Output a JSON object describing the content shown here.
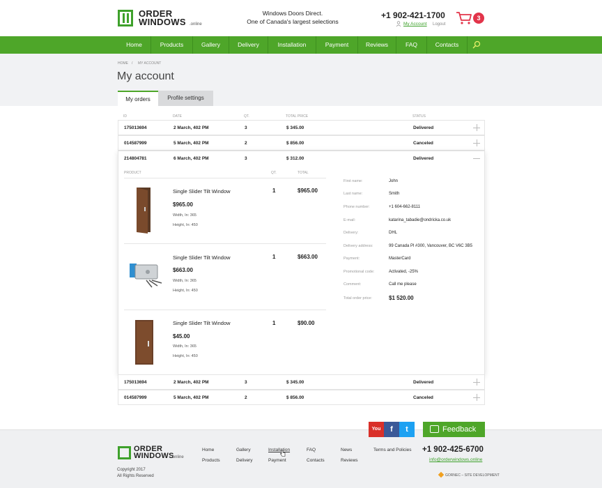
{
  "header": {
    "logo_line1": "ORDER",
    "logo_line2": "WINDOWS",
    "logo_suffix": ".online",
    "tagline1": "Windows Doors Direct.",
    "tagline2": "One of Canada's largest selections",
    "phone": "+1 902-421-1700",
    "my_account": "My Account",
    "logout": "Logout",
    "cart_count": "3"
  },
  "nav": [
    "Home",
    "Products",
    "Gallery",
    "Delivery",
    "Installation",
    "Payment",
    "Reviews",
    "FAQ",
    "Contacts"
  ],
  "breadcrumb": {
    "home": "HOME",
    "sep": "/",
    "current": "MY ACCOUNT"
  },
  "page_title": "My account",
  "tabs": {
    "orders": "My orders",
    "profile": "Profile settings"
  },
  "table_headers": {
    "id": "ID",
    "date": "DATE",
    "qty": "QT.",
    "total": "TOTAL PRICE",
    "status": "STATUS"
  },
  "orders_top": [
    {
      "id": "175013694",
      "date": "2 March, 402 PM",
      "qty": "3",
      "total": "$ 345.00",
      "status": "Delivered"
    },
    {
      "id": "014587999",
      "date": "5 March, 402 PM",
      "qty": "2",
      "total": "$ 856.00",
      "status": "Canceled"
    }
  ],
  "order_expanded": {
    "id": "214804781",
    "date": "6 March, 402 PM",
    "qty": "3",
    "total": "$ 312.00",
    "status": "Delivered"
  },
  "product_headers": {
    "product": "PRODUCT",
    "qty": "QT.",
    "total": "TOTAL"
  },
  "products": [
    {
      "name": "Single Slider Tilt Window",
      "price": "$965.00",
      "width": "Width, In: 365",
      "height": "Height, In: 450",
      "qty": "1",
      "total": "$965.00"
    },
    {
      "name": "Single Slider Tilt Window",
      "price": "$663.00",
      "width": "Width, In: 365",
      "height": "Height, In: 450",
      "qty": "1",
      "total": "$663.00"
    },
    {
      "name": "Single Slider Tilt Window",
      "price": "$45.00",
      "width": "Width, In: 365",
      "height": "Height, In: 450",
      "qty": "1",
      "total": "$90.00"
    }
  ],
  "info": {
    "first_name": {
      "label": "First name:",
      "value": "John"
    },
    "last_name": {
      "label": "Last name:",
      "value": "Smith"
    },
    "phone": {
      "label": "Phone number:",
      "value": "+1 604-662-8111"
    },
    "email": {
      "label": "E-mail:",
      "value": "katarina_tabadie@ondricka.co.uk"
    },
    "delivery": {
      "label": "Delivery:",
      "value": "DHL"
    },
    "address": {
      "label": "Delivery address:",
      "value": "99 Canada Pl #300, Vancouver, BC V6C 3B5"
    },
    "payment": {
      "label": "Payment:",
      "value": "MasterCard"
    },
    "promo": {
      "label": "Promotional code:",
      "value": "Activated, -25%"
    },
    "comment": {
      "label": "Comment:",
      "value": "Call me please"
    },
    "total": {
      "label": "Total order price:",
      "value": "$1 520.00"
    }
  },
  "orders_bottom": [
    {
      "id": "175013694",
      "date": "2 March, 402 PM",
      "qty": "3",
      "total": "$ 345.00",
      "status": "Delivered"
    },
    {
      "id": "014587999",
      "date": "5 March, 402 PM",
      "qty": "2",
      "total": "$ 856.00",
      "status": "Canceled"
    }
  ],
  "social": {
    "youtube": "You",
    "facebook": "f",
    "twitter": "t"
  },
  "feedback": "Feedback",
  "footer": {
    "col1": [
      "Home",
      "Products"
    ],
    "col2": [
      "Gallery",
      "Delivery"
    ],
    "col3": [
      "Installation",
      "Payment"
    ],
    "col4": [
      "FAQ",
      "Contacts"
    ],
    "col5": [
      "News",
      "Reviews"
    ],
    "terms": "Terms and Policies",
    "phone": "+1 902-425-6700",
    "email": "info@orderwindows.online",
    "copyright1": "Copyright 2017",
    "copyright2": "All Rights Reserved",
    "dev": "GORNEC – SITE DEVELOPMENT"
  },
  "colors": {
    "brand_green": "#4ea629",
    "badge_red": "#e2344a",
    "youtube": "#d9302a",
    "facebook": "#3b5998",
    "twitter": "#1da1f2"
  }
}
